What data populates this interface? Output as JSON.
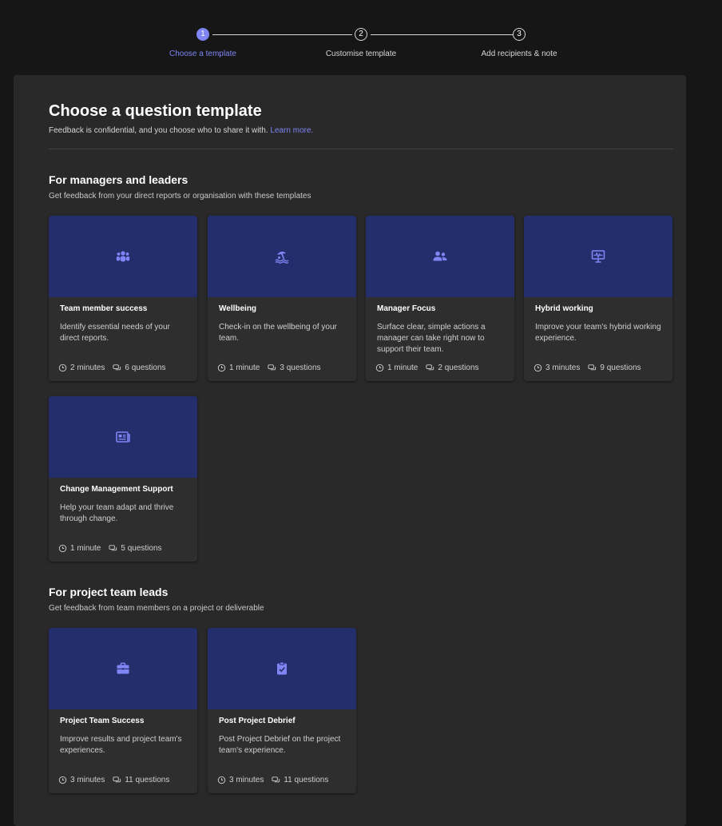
{
  "stepper": {
    "steps": [
      {
        "number": "1",
        "label": "Choose a template"
      },
      {
        "number": "2",
        "label": "Customise template"
      },
      {
        "number": "3",
        "label": "Add recipients & note"
      }
    ]
  },
  "header": {
    "title": "Choose a question template",
    "subtitle": "Feedback is confidential, and you choose who to share it with.",
    "learn_more": "Learn more."
  },
  "sections": [
    {
      "title": "For managers and leaders",
      "subtitle": "Get feedback from your direct reports or organisation with these templates",
      "cards": [
        {
          "title": "Team member success",
          "desc": "Identify essential needs of your direct reports.",
          "time": "2 minutes",
          "questions": "6 questions",
          "icon": "team-icon"
        },
        {
          "title": "Wellbeing",
          "desc": "Check-in on the wellbeing of your team.",
          "time": "1 minute",
          "questions": "3 questions",
          "icon": "beach-icon"
        },
        {
          "title": "Manager Focus",
          "desc": "Surface clear, simple actions a manager can take right now to support their team.",
          "time": "1 minute",
          "questions": "2 questions",
          "icon": "people-icon"
        },
        {
          "title": "Hybrid working",
          "desc": "Improve your team's hybrid working experience.",
          "time": "3 minutes",
          "questions": "9 questions",
          "icon": "monitor-icon"
        },
        {
          "title": "Change Management Support",
          "desc": "Help your team adapt and thrive through change.",
          "time": "1 minute",
          "questions": "5 questions",
          "icon": "news-icon"
        }
      ]
    },
    {
      "title": "For project team leads",
      "subtitle": "Get feedback from team members on a project or deliverable",
      "cards": [
        {
          "title": "Project Team Success",
          "desc": "Improve results and project team's experiences.",
          "time": "3 minutes",
          "questions": "11 questions",
          "icon": "briefcase-icon"
        },
        {
          "title": "Post Project Debrief",
          "desc": "Post Project Debrief on the project team's experience.",
          "time": "3 minutes",
          "questions": "11 questions",
          "icon": "clipboard-check-icon"
        }
      ]
    }
  ],
  "colors": {
    "accent": "#7f85f5",
    "card_banner": "#252e6c"
  }
}
